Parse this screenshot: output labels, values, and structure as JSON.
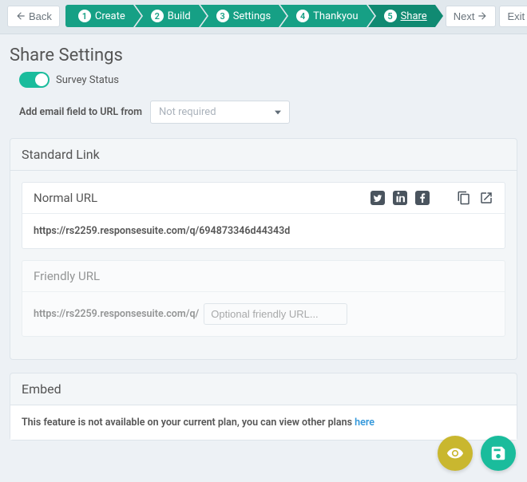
{
  "nav": {
    "back": "Back",
    "next": "Next",
    "exit": "Exit",
    "steps": [
      {
        "num": "1",
        "label": "Create"
      },
      {
        "num": "2",
        "label": "Build"
      },
      {
        "num": "3",
        "label": "Settings"
      },
      {
        "num": "4",
        "label": "Thankyou"
      },
      {
        "num": "5",
        "label": "Share"
      }
    ]
  },
  "page": {
    "title": "Share Settings",
    "status_label": "Survey Status",
    "email_field_label": "Add email field to URL from",
    "email_field_value": "Not required"
  },
  "standard_link": {
    "heading": "Standard Link",
    "normal": {
      "heading": "Normal URL",
      "url": "https://rs2259.responsesuite.com/q/694873346d44343d"
    },
    "friendly": {
      "heading": "Friendly URL",
      "prefix": "https://rs2259.responsesuite.com/q/",
      "placeholder": "Optional friendly URL..."
    }
  },
  "embed": {
    "heading": "Embed",
    "message": "This feature is not available on your current plan, you can view other plans ",
    "link_text": "here"
  }
}
